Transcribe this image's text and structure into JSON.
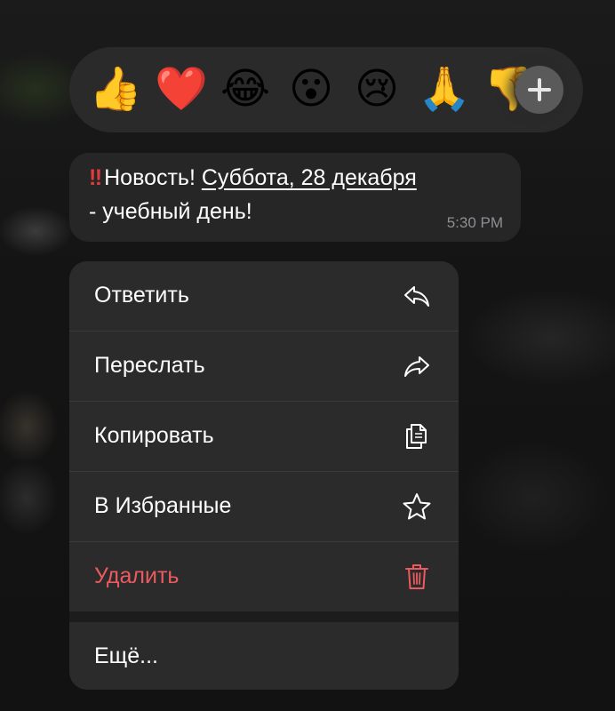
{
  "reactions": [
    {
      "emoji": "👍",
      "name": "thumbs-up"
    },
    {
      "emoji": "❤️",
      "name": "heart"
    },
    {
      "emoji": "😂",
      "name": "tears-of-joy"
    },
    {
      "emoji": "😮",
      "name": "surprised"
    },
    {
      "emoji": "😢",
      "name": "crying"
    },
    {
      "emoji": "🙏",
      "name": "folded-hands"
    },
    {
      "emoji": "👎",
      "name": "thumbs-down"
    }
  ],
  "message": {
    "emphasis": "‼",
    "text_before_link": "Новость! ",
    "link_text": "Суббота, 28 декабря",
    "text_line2": "- учебный день!",
    "time": "5:30 PM"
  },
  "menu": {
    "items": [
      {
        "label": "Ответить",
        "icon": "reply-icon"
      },
      {
        "label": "Переслать",
        "icon": "forward-icon"
      },
      {
        "label": "Копировать",
        "icon": "copy-icon"
      },
      {
        "label": "В Избранные",
        "icon": "star-icon"
      },
      {
        "label": "Удалить",
        "icon": "trash-icon"
      }
    ],
    "more_label": "Ещё..."
  },
  "colors": {
    "danger": "#eb5a5f",
    "emphasis": "#e23b3b",
    "menu_bg": "#2b2b2b",
    "bubble_bg": "#262626"
  }
}
